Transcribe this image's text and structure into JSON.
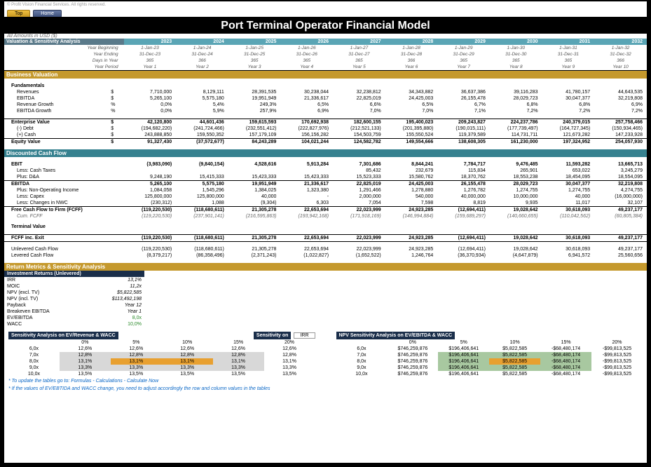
{
  "header": {
    "copyright": "© Profit Vision Financial Services. All rights reserved.",
    "btn_top": "Top",
    "btn_home": "Home",
    "title": "Port Terminal Operator Financial Model",
    "currency": "All Amounts in  USD ($)"
  },
  "years": [
    "2023",
    "2024",
    "2025",
    "2026",
    "2027",
    "2028",
    "2029",
    "2030",
    "2031",
    "2032"
  ],
  "year_rows": {
    "yb": {
      "l": "Year Beginning",
      "v": [
        "1-Jan-23",
        "1-Jan-24",
        "1-Jan-25",
        "1-Jan-26",
        "1-Jan-27",
        "1-Jan-28",
        "1-Jan-29",
        "1-Jan-30",
        "1-Jan-31",
        "1-Jan-32"
      ]
    },
    "ye": {
      "l": "Year Ending",
      "v": [
        "31-Dec-23",
        "31-Dec-24",
        "31-Dec-25",
        "31-Dec-26",
        "31-Dec-27",
        "31-Dec-28",
        "31-Dec-29",
        "31-Dec-30",
        "31-Dec-31",
        "31-Dec-32"
      ]
    },
    "dy": {
      "l": "Days in Year",
      "v": [
        "365",
        "366",
        "365",
        "365",
        "365",
        "366",
        "365",
        "365",
        "365",
        "366"
      ]
    },
    "yp": {
      "l": "Year Period",
      "v": [
        "Year 1",
        "Year 2",
        "Year 3",
        "Year 4",
        "Year 5",
        "Year 6",
        "Year 7",
        "Year 8",
        "Year 9",
        "Year 10"
      ]
    }
  },
  "sect": {
    "val": "Valuation & Sensitivity Analysis",
    "biz": "Business Valuation",
    "fund": "Fundamentals",
    "dcf": "Discounted Cash Flow",
    "ret": "Return Metrics & Sensitivity Analysis",
    "inv": "Investment Returns (Unlevered)"
  },
  "fund": {
    "rev": {
      "l": "Revenues",
      "u": "$",
      "v": [
        "7,710,000",
        "8,129,111",
        "28,391,535",
        "30,238,044",
        "32,238,812",
        "34,343,882",
        "36,637,386",
        "39,116,283",
        "41,780,157",
        "44,643,535"
      ]
    },
    "ebitda": {
      "l": "EBITDA",
      "u": "$",
      "v": [
        "5,265,100",
        "5,575,180",
        "19,951,949",
        "21,336,617",
        "22,825,019",
        "24,425,003",
        "26,155,478",
        "28,029,723",
        "30,047,377",
        "32,219,808"
      ]
    },
    "rg": {
      "l": "Revenue Growth",
      "u": "%",
      "v": [
        "0,0%",
        "5,4%",
        "249,3%",
        "6,5%",
        "6,6%",
        "6,5%",
        "6,7%",
        "6,8%",
        "6,8%",
        "6,9%"
      ]
    },
    "eg": {
      "l": "EBITDA Growth",
      "u": "%",
      "v": [
        "0,0%",
        "5,9%",
        "257,9%",
        "6,9%",
        "7,0%",
        "7,0%",
        "7,1%",
        "7,2%",
        "7,2%",
        "7,2%"
      ]
    },
    "ev": {
      "l": "Enterprise Value",
      "u": "$",
      "v": [
        "42,120,800",
        "44,601,436",
        "159,615,593",
        "170,692,938",
        "182,600,155",
        "195,400,023",
        "209,243,827",
        "224,237,786",
        "240,379,015",
        "257,758,466"
      ]
    },
    "debt": {
      "l": "(-) Debt",
      "u": "$",
      "v": [
        "(194,682,220)",
        "(241,724,466)",
        "(232,551,412)",
        "(222,827,976)",
        "(212,521,133)",
        "(201,395,880)",
        "(190,015,111)",
        "(177,739,497)",
        "(164,727,345)",
        "(150,934,465)"
      ]
    },
    "cash": {
      "l": "(+) Cash",
      "u": "$",
      "v": [
        "243,888,850",
        "159,550,352",
        "157,179,109",
        "156,156,282",
        "154,503,759",
        "155,550,524",
        "119,379,589",
        "114,731,711",
        "121,673,282",
        "147,233,928"
      ]
    },
    "eq": {
      "l": "Equity Value",
      "u": "$",
      "v": [
        "91,327,430",
        "(37,572,677)",
        "84,243,289",
        "104,021,244",
        "124,582,782",
        "149,554,666",
        "138,608,305",
        "161,230,000",
        "197,324,952",
        "254,057,930"
      ]
    }
  },
  "dcf": {
    "ebit": {
      "l": "EBIT",
      "v": [
        "(3,983,090)",
        "(9,840,154)",
        "4,528,616",
        "5,913,284",
        "7,301,686",
        "8,844,241",
        "7,784,717",
        "9,476,485",
        "11,593,282",
        "13,665,713"
      ]
    },
    "tax": {
      "l": "Less: Cash Taxes",
      "v": [
        "",
        "",
        "",
        "",
        "85,432",
        "232,679",
        "115,834",
        "265,901",
        "653,022",
        "3,245,279"
      ]
    },
    "da": {
      "l": "Plus: D&A",
      "v": [
        "9,248,190",
        "15,415,333",
        "15,423,333",
        "15,423,333",
        "15,523,333",
        "15,580,762",
        "18,370,762",
        "18,553,238",
        "18,454,095",
        "18,554,095"
      ]
    },
    "ebitda": {
      "l": "EBITDA",
      "v": [
        "5,265,100",
        "5,575,180",
        "19,951,949",
        "21,336,617",
        "22,825,019",
        "24,425,003",
        "26,155,478",
        "28,029,723",
        "30,047,377",
        "32,219,808"
      ]
    },
    "nop": {
      "l": "Plus: Non-Operating Income",
      "v": [
        "1,084,058",
        "1,545,296",
        "1,384,025",
        "1,323,380",
        "1,291,466",
        "1,278,880",
        "1,276,782",
        "1,274,755",
        "1,274,755",
        "4,274,755"
      ]
    },
    "capex": {
      "l": "Less: Capex",
      "v": [
        "125,800,000",
        "125,800,000",
        "40,000",
        "-",
        "2,000,000",
        "540,000",
        "40,000,000",
        "10,000,000",
        "40,000",
        "(16,000,000)"
      ]
    },
    "nwc": {
      "l": "Less: Changes in NWC",
      "v": [
        "(230,312)",
        "1,088",
        "(9,304)",
        "6,303",
        "7,054",
        "7,598",
        "8,819",
        "9,935",
        "11,017",
        "32,107"
      ]
    },
    "fcff": {
      "l": "Free Cash Flow to Firm (FCFF)",
      "v": [
        "(119,220,530)",
        "(118,680,611)",
        "21,305,278",
        "22,653,694",
        "22,023,999",
        "24,923,285",
        "(12,694,411)",
        "19,028,642",
        "30,618,093",
        "49,237,177"
      ]
    },
    "cum": {
      "l": "Cum. FCFF",
      "v": [
        "(119,220,530)",
        "(237,901,141)",
        "(216,595,863)",
        "(193,942,168)",
        "(171,918,169)",
        "(146,994,884)",
        "(159,689,297)",
        "(140,660,655)",
        "(110,042,562)",
        "(60,805,384)"
      ]
    },
    "tv": {
      "l": "Terminal Value",
      "v": [
        "",
        "",
        "",
        "",
        "",
        "",
        "",
        "",
        "",
        ""
      ]
    },
    "fcffex": {
      "l": "FCFF inc. Exit",
      "v": [
        "(119,220,530)",
        "(118,680,611)",
        "21,305,278",
        "22,653,694",
        "22,023,999",
        "24,923,285",
        "(12,694,411)",
        "19,028,642",
        "30,618,093",
        "49,237,177"
      ]
    },
    "unlev": {
      "l": "Unlevered Cash Flow",
      "v": [
        "(119,220,530)",
        "(118,680,611)",
        "21,305,278",
        "22,653,694",
        "22,023,999",
        "24,923,285",
        "(12,694,411)",
        "19,028,642",
        "30,618,093",
        "49,237,177"
      ]
    },
    "lev": {
      "l": "Levered Cash Flow",
      "v": [
        "(8,379,217)",
        "(86,358,496)",
        "(2,371,243)",
        "(1,022,827)",
        "(1,652,522)",
        "1,246,764",
        "(36,370,934)",
        "(4,647,879)",
        "6,941,572",
        "25,560,656"
      ]
    }
  },
  "metrics": {
    "irr": {
      "l": "IRR",
      "v": "13,1%"
    },
    "moic": {
      "l": "MOIC",
      "v": "11,2x"
    },
    "npv_ex": {
      "l": "NPV (excl. TV)",
      "v": "$5,822,585"
    },
    "npv_in": {
      "l": "NPV (incl. TV)",
      "v": "$113,492,198"
    },
    "payback": {
      "l": "Payback",
      "v": "Year 12"
    },
    "be": {
      "l": "Breakeven EBITDA",
      "v": "Year 1"
    },
    "evebitda": {
      "l": "EV/EBITDA",
      "v": "8,0x"
    },
    "wacc": {
      "l": "WACC",
      "v": "10,0%"
    }
  },
  "sens1": {
    "title_l": "Sensitivity Analysis on EV/Revenue & WACC",
    "title_m": "Sensitivity on",
    "metric": "IRR",
    "cols": [
      "0%",
      "5%",
      "10%",
      "15%",
      "20%"
    ],
    "rows": [
      {
        "h": "6,0x",
        "v": [
          "12,6%",
          "12,6%",
          "12,6%",
          "12,6%",
          "12,6%"
        ]
      },
      {
        "h": "7,0x",
        "v": [
          "12,8%",
          "12,8%",
          "12,8%",
          "12,8%",
          "12,8%"
        ]
      },
      {
        "h": "8,0x",
        "v": [
          "13,1%",
          "13,1%",
          "13,1%",
          "13,1%",
          "13,1%"
        ]
      },
      {
        "h": "9,0x",
        "v": [
          "13,3%",
          "13,3%",
          "13,3%",
          "13,3%",
          "13,3%"
        ]
      },
      {
        "h": "10,0x",
        "v": [
          "13,5%",
          "13,5%",
          "13,5%",
          "13,5%",
          "13,5%"
        ]
      }
    ]
  },
  "sens2": {
    "title": "NPV Sensitivity Analysis on EV/EBITDA & WACC",
    "cols": [
      "0%",
      "5%",
      "10%",
      "15%",
      "20%"
    ],
    "rows": [
      {
        "h": "6,0x",
        "v": [
          "$746,259,876",
          "$196,406,641",
          "$5,822,585",
          "-$68,480,174",
          "-$99,813,525"
        ]
      },
      {
        "h": "7,0x",
        "v": [
          "$746,259,876",
          "$196,406,641",
          "$5,822,585",
          "-$68,480,174",
          "-$99,813,525"
        ]
      },
      {
        "h": "8,0x",
        "v": [
          "$746,259,876",
          "$196,406,641",
          "$5,822,585",
          "-$68,480,174",
          "-$99,813,525"
        ]
      },
      {
        "h": "9,0x",
        "v": [
          "$746,259,876",
          "$196,406,641",
          "$5,822,585",
          "-$68,480,174",
          "-$99,813,525"
        ]
      },
      {
        "h": "10,0x",
        "v": [
          "$746,259,876",
          "$196,406,641",
          "$5,822,585",
          "-$68,480,174",
          "-$99,813,525"
        ]
      }
    ]
  },
  "notes": {
    "n1": "* To update the tables go to: Formulas - Calculations - Calculate Now",
    "n2": "* If the values of EV/EBTIDA and WACC change, you need to adjust accordingly the row and column values in the tables"
  }
}
